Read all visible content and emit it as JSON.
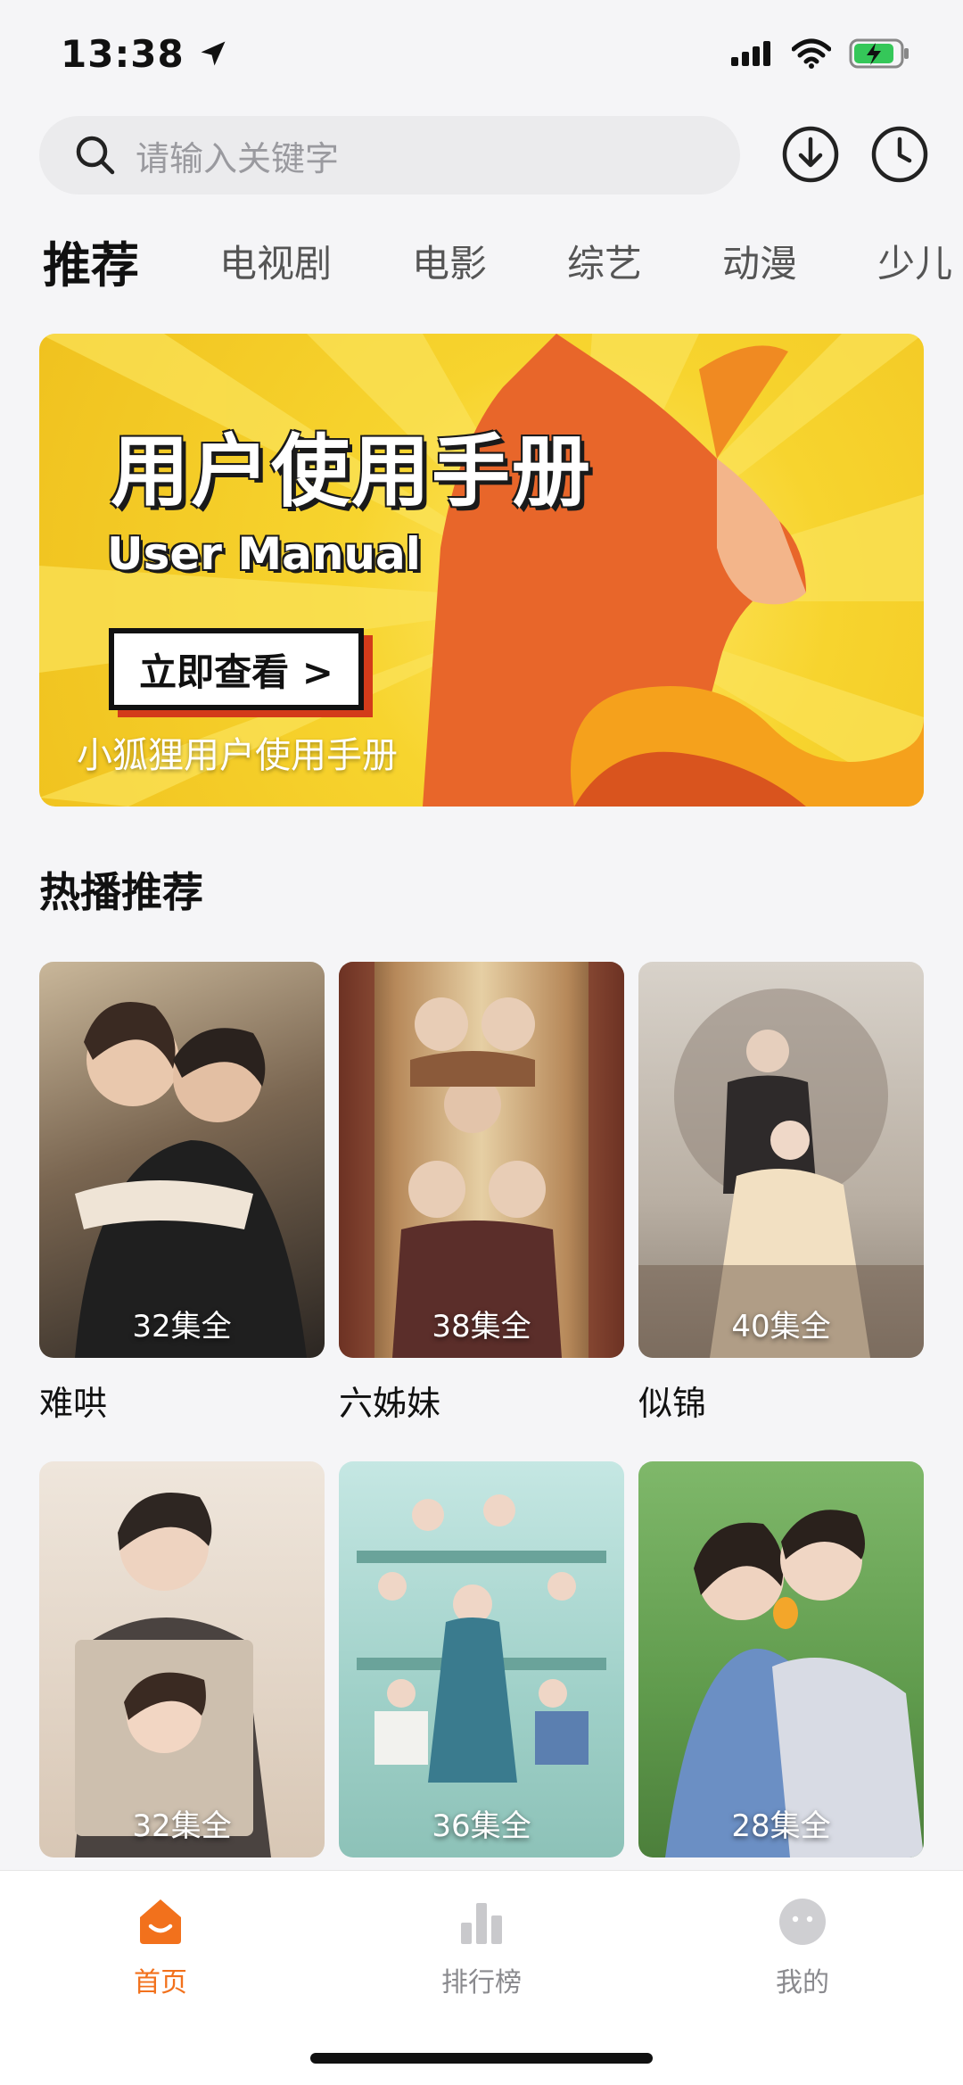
{
  "status": {
    "time": "13:38",
    "battery_color": "#35c759"
  },
  "search": {
    "placeholder": "请输入关键字"
  },
  "header_icons": [
    "download-icon",
    "history-clock-icon"
  ],
  "tabs": [
    {
      "label": "推荐",
      "active": true
    },
    {
      "label": "电视剧"
    },
    {
      "label": "电影"
    },
    {
      "label": "综艺"
    },
    {
      "label": "动漫"
    },
    {
      "label": "少儿"
    }
  ],
  "banner": {
    "title": "用户使用手册",
    "subtitle": "User Manual",
    "button": "立即查看 >",
    "caption": "小狐狸用户使用手册"
  },
  "section": {
    "title": "热播推荐"
  },
  "cards": [
    {
      "title": "难哄",
      "episodes": "32集全"
    },
    {
      "title": "六姊妹",
      "episodes": "38集全"
    },
    {
      "title": "似锦",
      "episodes": "40集全"
    },
    {
      "title": "",
      "episodes": "32集全"
    },
    {
      "title": "",
      "episodes": "36集全"
    },
    {
      "title": "",
      "episodes": "28集全"
    }
  ],
  "nav": [
    {
      "label": "首页",
      "active": true
    },
    {
      "label": "排行榜"
    },
    {
      "label": "我的"
    }
  ],
  "colors": {
    "accent": "#f2711c",
    "banner_yellow": "#f7d42e",
    "fox_orange": "#e8662a"
  }
}
